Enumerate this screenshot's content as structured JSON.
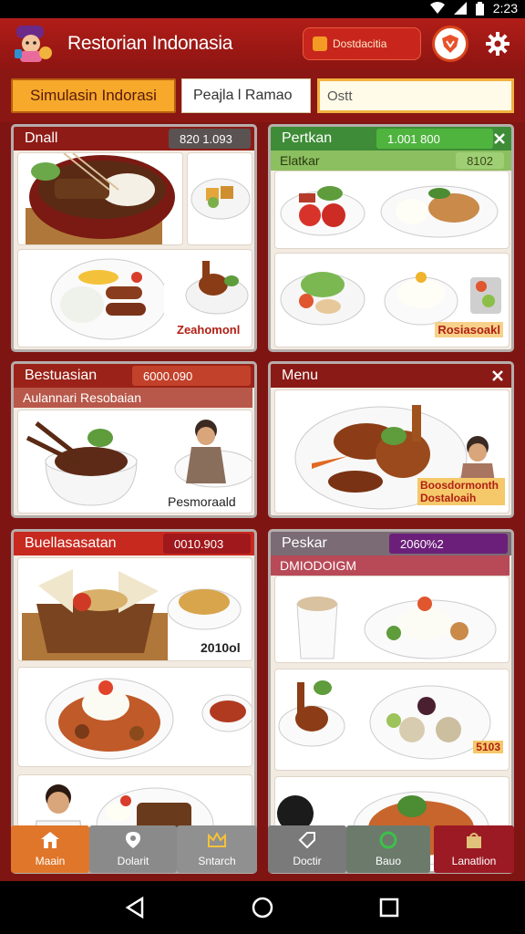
{
  "status": {
    "time": "2:23"
  },
  "header": {
    "title": "Restorian Indonasia",
    "promo_label": "Dostdacitia"
  },
  "toolbar": {
    "tab_label": "Simulasin Indorasi",
    "field1_value": "Peajla l Ramao",
    "field2_value": "Ostt"
  },
  "panels": [
    {
      "title": "Dnall",
      "value": "820 1.093",
      "cells": [
        {
          "label": ""
        },
        {
          "label": ""
        },
        {
          "label": ""
        },
        {
          "label": "Zeahomonl"
        }
      ]
    },
    {
      "title": "Pertkan",
      "value": "1.001 800",
      "subtitle": "Elatkar",
      "subvalue": "8102",
      "cells": [
        {
          "label": ""
        },
        {
          "label": ""
        },
        {
          "label": ""
        },
        {
          "label": "Rosiasoakl"
        }
      ]
    },
    {
      "title": "Bestuasian",
      "value": "6000.090",
      "subtitle": "Aulannari Resobaian",
      "cells": [
        {
          "label": ""
        },
        {
          "label": "Pesmoraald"
        }
      ]
    },
    {
      "title": "Menu",
      "overlay": "Boosdormonth Dostaloaih"
    },
    {
      "title": "Buellasasatan",
      "value": "0010.903",
      "cells": [
        {
          "label": ""
        },
        {
          "label": "2010ol"
        },
        {
          "label": ""
        },
        {
          "label": ""
        },
        {
          "label": ""
        }
      ]
    },
    {
      "title": "Peskar",
      "value": "2060%2",
      "subtitle": "DMIODOIGM",
      "cells": [
        {
          "label": ""
        },
        {
          "label": ""
        },
        {
          "label": ""
        },
        {
          "label": "5103"
        },
        {
          "label": ""
        }
      ]
    }
  ],
  "bottom_tabs": [
    {
      "label": "Maain"
    },
    {
      "label": "Dolarit"
    },
    {
      "label": "Sntarch"
    },
    {
      "label": "Doctir"
    },
    {
      "label": "Bauo"
    },
    {
      "label": "Lanatlion"
    }
  ],
  "colors": {
    "appbar": "#b11d18",
    "background": "#7e1512",
    "accent_orange": "#f6a92a",
    "green_header": "#3e8c37",
    "purple_value": "#6b1f7a"
  }
}
